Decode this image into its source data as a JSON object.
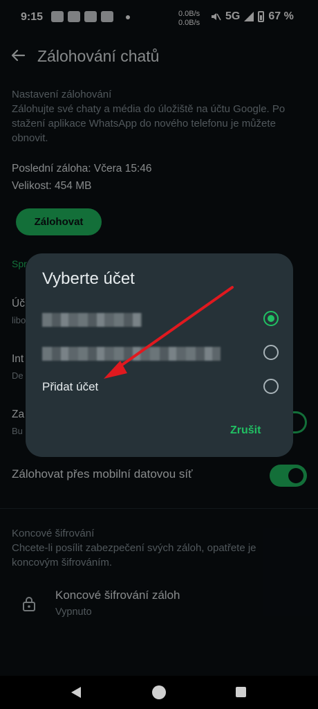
{
  "status_bar": {
    "time": "9:15",
    "speed_up": "0.0B/s",
    "speed_down": "0.0B/s",
    "network": "5G",
    "battery": "67 %"
  },
  "app_bar": {
    "title": "Zálohování chatů",
    "back_icon": "arrow-back-icon"
  },
  "backup_settings": {
    "heading": "Nastavení zálohování",
    "description": "Zálohujte své chaty a média do úložiště na účtu Google. Po stažení aplikace WhatsApp do nového telefonu je můžete obnovit.",
    "last_backup": "Poslední záloha: Včera 15:46",
    "size": "Velikost: 454 MB",
    "backup_button": "Zálohovat"
  },
  "obscured": {
    "section_label_partial": "Spr",
    "account_label_partial": "Úč",
    "account_sub_partial": "libo",
    "interval_label_partial": "Int",
    "interval_sub_partial": "De",
    "video_label_partial": "Za",
    "video_sub_partial": "Bu"
  },
  "mobile_data": {
    "label": "Zálohovat přes mobilní datovou síť",
    "enabled": true
  },
  "e2e": {
    "heading": "Koncové šifrování",
    "description": "Chcete-li posílit zabezpečení svých záloh, opatřete je koncovým šifrováním.",
    "item_title": "Koncové šifrování záloh",
    "item_status": "Vypnuto",
    "icon": "lock-icon"
  },
  "dialog": {
    "title": "Vyberte účet",
    "accounts": [
      {
        "selected": true
      },
      {
        "selected": false
      }
    ],
    "add_account": "Přidat účet",
    "cancel": "Zrušit"
  },
  "colors": {
    "accent": "#21c063",
    "background": "#0b1014",
    "dialog": "#263238",
    "annotation_arrow": "#e0191f"
  }
}
